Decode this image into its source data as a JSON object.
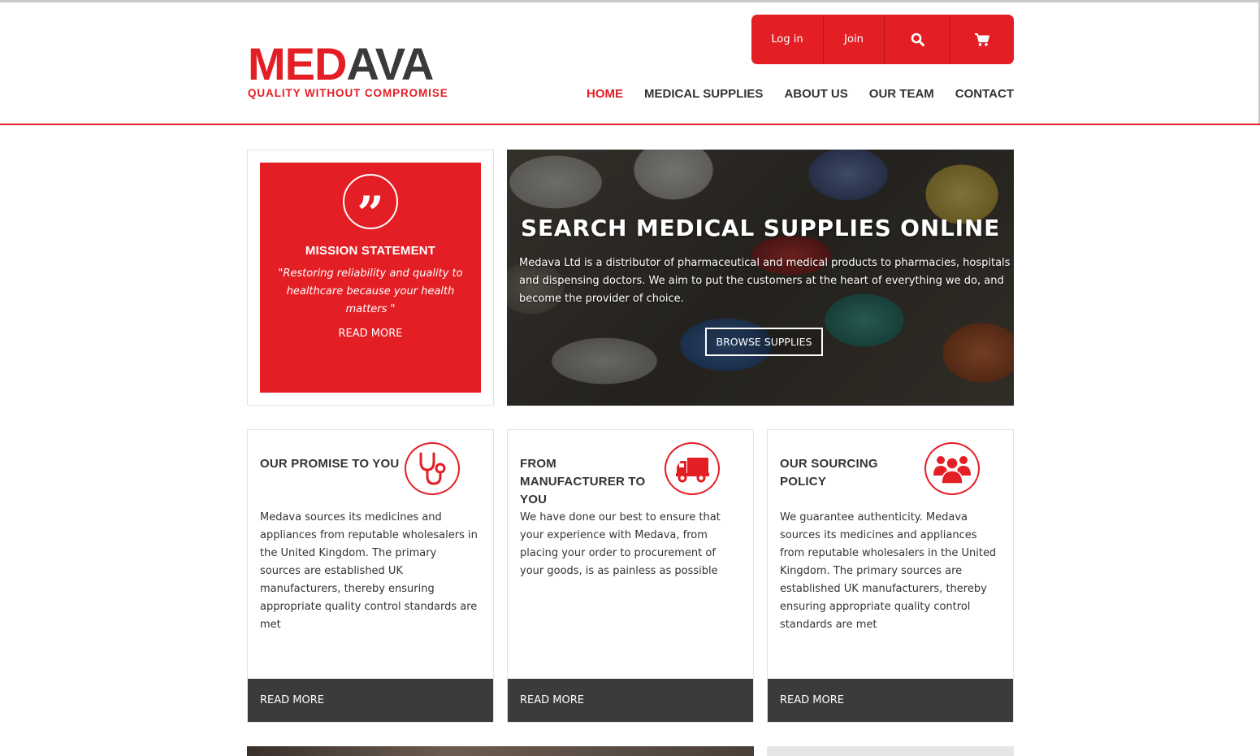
{
  "brand": {
    "logo_red": "MED",
    "logo_dark": "AVA",
    "tagline": "QUALITY WITHOUT COMPROMISE",
    "accent_color": "#e31e24",
    "dark_color": "#3b3b3b"
  },
  "topbar": {
    "login_label": "Log in",
    "join_label": "Join",
    "search_icon": "search-icon",
    "cart_icon": "cart-icon"
  },
  "nav": {
    "items": [
      {
        "label": "HOME",
        "active": true
      },
      {
        "label": "MEDICAL SUPPLIES",
        "active": false
      },
      {
        "label": "ABOUT US",
        "active": false
      },
      {
        "label": "OUR TEAM",
        "active": false
      },
      {
        "label": "CONTACT",
        "active": false
      }
    ]
  },
  "mission": {
    "icon": "quote-icon",
    "title": "MISSION STATEMENT",
    "quote": "\"Restoring reliability and quality to healthcare because your health matters \"",
    "read_more": "READ MORE"
  },
  "hero": {
    "title": "SEARCH MEDICAL SUPPLIES ONLINE",
    "text": "Medava Ltd is a distributor of pharmaceutical and medical products to pharmacies, hospitals and dispensing doctors. We aim to put the customers at the heart of everything we do, and become the provider of choice.",
    "button_label": "BROWSE SUPPLIES"
  },
  "cards": [
    {
      "title": "OUR PROMISE TO YOU",
      "icon": "stethoscope-icon",
      "text": "Medava sources its medicines and appliances from reputable wholesalers in the United Kingdom. The primary sources are established UK manufacturers, thereby ensuring appropriate quality control standards are met",
      "read_more": "READ MORE"
    },
    {
      "title": "FROM MANUFACTURER TO YOU",
      "icon": "truck-icon",
      "text": "We have done our best to ensure that your experience with Medava, from placing your order to procurement of your goods, is as painless as possible",
      "read_more": "READ MORE"
    },
    {
      "title": "OUR SOURCING POLICY",
      "icon": "users-icon",
      "text": "We guarantee authenticity. Medava sources its medicines and appliances from reputable wholesalers in the United Kingdom. The primary sources are established UK manufacturers, thereby ensuring appropriate quality control standards are met",
      "read_more": "READ MORE"
    }
  ]
}
